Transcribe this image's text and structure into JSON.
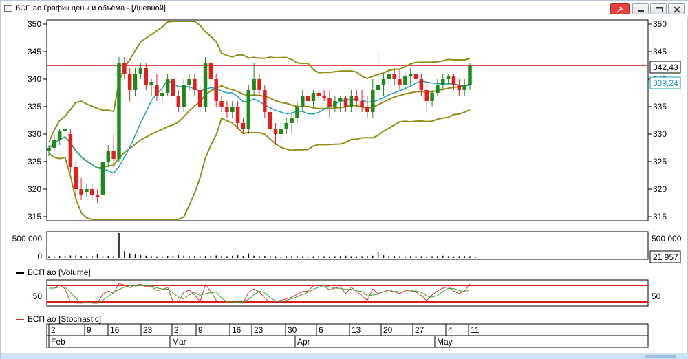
{
  "window": {
    "title": "БСП ао График цены и объёма - [Дневной]"
  },
  "colors": {
    "up": "#1e8a1e",
    "down": "#e21e1e",
    "bollinger": "#8f8f15",
    "ma": "#1aa0b4",
    "hline": "#d94a4a",
    "stoch_k": "#d83030",
    "stoch_d": "#2fa82f",
    "stoch_band": "#d81c1c"
  },
  "price_panel": {
    "y_ticks": [
      "350",
      "345",
      "340",
      "335",
      "330",
      "325",
      "320",
      "315"
    ],
    "last_price_label": "342,43",
    "ma_value_label": "339,24",
    "hline_value": 342.43
  },
  "volume_panel": {
    "y_ticks": [
      "500 000",
      "0"
    ],
    "right_ticks": [
      "500 000"
    ],
    "last_volume_label": "21 957",
    "legend": "БСП ао [Volume]"
  },
  "stoch_panel": {
    "y_tick": "50",
    "legend": "БСП ао [Stochastic]"
  },
  "x_axis": {
    "days": [
      "2",
      "9",
      "16",
      "23",
      "2",
      "9",
      "16",
      "23",
      "30",
      "6",
      "13",
      "20",
      "27",
      "4",
      "11"
    ],
    "months": [
      "Feb",
      "Mar",
      "Apr",
      "May"
    ]
  },
  "chart_data": {
    "type": "candlestick",
    "y_range": [
      315,
      350
    ],
    "volume_range": [
      0,
      500000
    ],
    "stochastic_range": [
      0,
      100
    ],
    "series": [
      {
        "name": "БСП ао",
        "candles": [
          [
            327,
            328,
            326,
            327.5
          ],
          [
            327.5,
            330,
            327,
            329
          ],
          [
            329,
            331,
            328,
            330.5
          ],
          [
            330.5,
            333,
            330,
            331
          ],
          [
            330,
            331,
            323,
            324
          ],
          [
            324,
            325,
            319,
            320
          ],
          [
            320,
            322,
            318,
            319
          ],
          [
            319.5,
            321,
            318.5,
            320
          ],
          [
            320,
            321,
            318,
            319
          ],
          [
            319,
            320,
            317.5,
            318.5
          ],
          [
            319,
            326,
            318,
            325
          ],
          [
            325,
            328,
            324,
            327
          ],
          [
            327,
            330,
            324,
            325.5
          ],
          [
            325.5,
            344,
            325,
            343
          ],
          [
            343,
            344,
            340,
            341
          ],
          [
            341,
            342,
            336,
            338
          ],
          [
            338,
            342,
            337,
            341
          ],
          [
            341,
            343,
            340,
            342
          ],
          [
            342,
            343,
            338,
            339
          ],
          [
            339,
            340,
            337,
            339.5
          ],
          [
            339,
            341,
            336,
            337
          ],
          [
            337,
            338,
            336,
            337.5
          ],
          [
            337.5,
            341,
            337,
            340
          ],
          [
            340,
            341,
            336,
            337
          ],
          [
            337,
            338,
            334,
            335
          ],
          [
            335,
            340,
            334,
            339
          ],
          [
            339,
            341,
            338,
            340
          ],
          [
            340,
            341,
            337,
            338
          ],
          [
            338,
            339,
            334,
            335
          ],
          [
            335,
            344,
            334,
            343
          ],
          [
            343,
            344,
            339,
            340
          ],
          [
            340,
            341,
            335,
            336
          ],
          [
            336,
            337,
            334,
            335
          ],
          [
            335,
            336,
            333,
            334
          ],
          [
            334,
            336,
            333,
            335
          ],
          [
            335,
            336,
            331,
            332
          ],
          [
            332,
            333,
            330,
            331
          ],
          [
            331,
            339,
            330,
            338
          ],
          [
            338,
            343,
            337,
            340
          ],
          [
            340,
            341,
            337,
            338
          ],
          [
            338,
            339,
            333,
            334
          ],
          [
            334,
            335,
            330,
            331
          ],
          [
            331,
            332,
            328,
            330
          ],
          [
            330,
            332,
            329,
            331
          ],
          [
            331,
            333,
            330,
            332
          ],
          [
            332,
            334,
            330,
            333
          ],
          [
            333,
            336,
            332,
            335
          ],
          [
            335,
            338,
            334,
            337
          ],
          [
            337,
            338,
            335,
            336
          ],
          [
            336,
            338,
            335,
            337.5
          ],
          [
            337.5,
            338,
            336,
            337
          ],
          [
            337,
            338,
            336,
            336.5
          ],
          [
            336.5,
            338,
            333,
            335
          ],
          [
            335,
            337,
            334,
            336
          ],
          [
            336,
            337,
            334,
            336.5
          ],
          [
            336.5,
            337,
            334,
            335
          ],
          [
            335,
            338,
            334,
            337
          ],
          [
            337,
            338,
            335,
            336
          ],
          [
            336,
            338,
            334,
            335
          ],
          [
            335,
            337,
            333,
            334
          ],
          [
            334,
            340,
            333,
            338
          ],
          [
            338,
            345,
            337,
            339
          ],
          [
            339,
            341,
            337,
            340
          ],
          [
            340,
            342,
            339,
            341
          ],
          [
            341,
            342,
            339,
            340
          ],
          [
            340,
            342,
            338,
            339
          ],
          [
            339,
            341,
            338,
            340.5
          ],
          [
            340.5,
            342,
            339,
            341
          ],
          [
            341,
            342,
            339,
            340
          ],
          [
            340,
            341,
            337,
            338
          ],
          [
            338,
            339,
            334,
            336
          ],
          [
            336,
            338,
            335,
            337.5
          ],
          [
            337.5,
            340,
            337,
            339
          ],
          [
            339,
            341,
            338,
            340
          ],
          [
            340,
            341,
            339,
            340.5
          ],
          [
            340.5,
            341,
            338,
            339
          ],
          [
            339,
            340,
            337,
            338
          ],
          [
            338,
            340,
            337,
            339
          ],
          [
            339,
            343,
            338,
            342.43
          ]
        ]
      }
    ],
    "volume": [
      40000,
      35000,
      45000,
      50000,
      55000,
      60000,
      45000,
      40000,
      50000,
      90000,
      40000,
      45000,
      45000,
      650000,
      150000,
      100000,
      80000,
      60000,
      50000,
      40000,
      35000,
      40000,
      45000,
      50000,
      60000,
      50000,
      40000,
      45000,
      40000,
      45000,
      50000,
      55000,
      45000,
      40000,
      50000,
      60000,
      45000,
      100000,
      50000,
      40000,
      45000,
      50000,
      40000,
      35000,
      40000,
      45000,
      50000,
      40000,
      35000,
      40000,
      45000,
      40000,
      35000,
      40000,
      45000,
      50000,
      40000,
      35000,
      40000,
      45000,
      50000,
      130000,
      60000,
      50000,
      45000,
      40000,
      35000,
      40000,
      45000,
      40000,
      35000,
      40000,
      45000,
      50000,
      40000,
      35000,
      40000,
      45000,
      40000,
      22000
    ]
  }
}
